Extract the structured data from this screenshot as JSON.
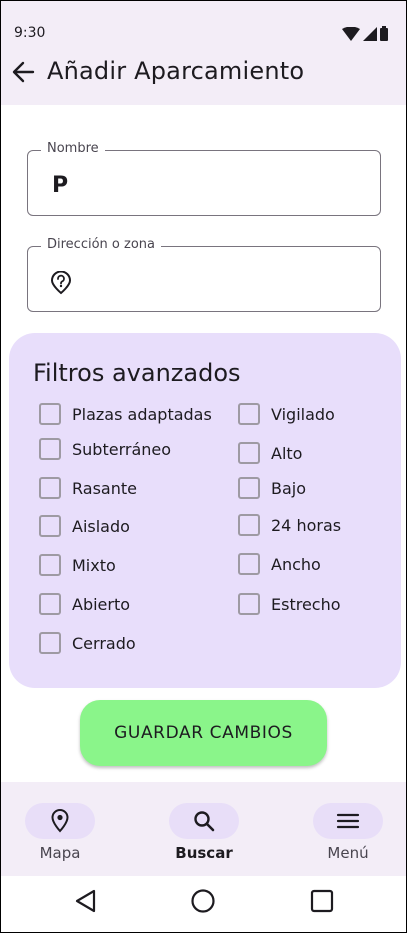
{
  "status": {
    "time": "9:30"
  },
  "header": {
    "title": "Añadir Aparcamiento"
  },
  "form": {
    "name": {
      "label": "Nombre",
      "value": "P"
    },
    "address": {
      "label": "Dirección o zona",
      "value": ""
    }
  },
  "filters": {
    "title": "Filtros avanzados",
    "left": [
      "Plazas adaptadas",
      "Subterráneo",
      "Rasante",
      "Aislado",
      "Mixto",
      "Abierto",
      "Cerrado"
    ],
    "right": [
      "Vigilado",
      "Alto",
      "Bajo",
      "24 horas",
      "Ancho",
      "Estrecho"
    ]
  },
  "actions": {
    "save_label": "GUARDAR  CAMBIOS"
  },
  "nav": {
    "items": [
      {
        "label": "Mapa",
        "icon": "location-pin-icon"
      },
      {
        "label": "Buscar",
        "icon": "search-icon",
        "active": true
      },
      {
        "label": "Menú",
        "icon": "menu-icon"
      }
    ]
  },
  "colors": {
    "accent": "#8af58a",
    "panel": "#e8defb",
    "bar": "#f3edf7"
  }
}
